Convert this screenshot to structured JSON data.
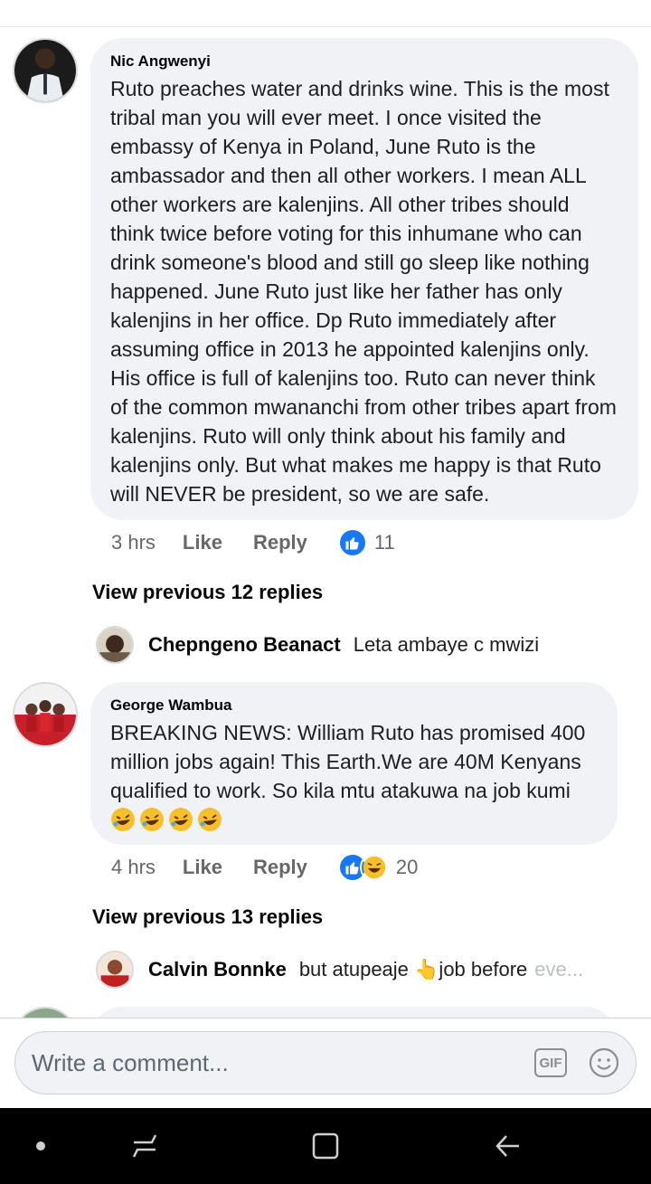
{
  "comments": [
    {
      "author": "Nic Angwenyi",
      "text": "Ruto preaches water and drinks wine. This is the most tribal man you will ever meet. I once visited the embassy of Kenya in Poland, June Ruto is the ambassador and then all other workers. I mean ALL other workers are kalenjins. All other tribes should think twice before voting for this inhumane who can drink someone's blood and still go sleep like nothing happened. June Ruto just like her father has only kalenjins in her office. Dp Ruto immediately after assuming office in 2013 he appointed kalenjins only. His office is full of kalenjins too. Ruto can never think of the common mwananchi from other tribes apart from kalenjins. Ruto will only think about his family and kalenjins only. But what makes me happy is that Ruto will NEVER be president, so we are safe.",
      "time": "3 hrs",
      "like_label": "Like",
      "reply_label": "Reply",
      "reaction_count": "11",
      "reactions": [
        "like-icon"
      ],
      "view_previous": "View previous 12 replies",
      "latest_reply": {
        "author": "Chepngeno Beanact",
        "text": "Leta ambaye c mwizi"
      }
    },
    {
      "author": "George Wambua",
      "text": "BREAKING NEWS: William Ruto has promised 400 million jobs again! This Earth.We are 40M Kenyans qualified to work. So kila mtu atakuwa na job kumi",
      "emoji": [
        "🤣",
        "🤣",
        "🤣",
        "🤣"
      ],
      "time": "4 hrs",
      "like_label": "Like",
      "reply_label": "Reply",
      "reaction_count": "20",
      "reactions": [
        "like-icon",
        "haha-icon"
      ],
      "view_previous": "View previous 13 replies",
      "latest_reply": {
        "author": "Calvin Bonnke",
        "text": "but atupeaje 👆job before",
        "text_faded": "eve..."
      }
    }
  ],
  "composer": {
    "placeholder": "Write a comment...",
    "gif_label": "GIF"
  },
  "colors": {
    "accent": "#1877f2",
    "bubble": "#f0f2f5",
    "meta": "#65676b"
  },
  "navbar": [
    "dot-icon",
    "recents-icon",
    "home-icon",
    "back-icon"
  ]
}
